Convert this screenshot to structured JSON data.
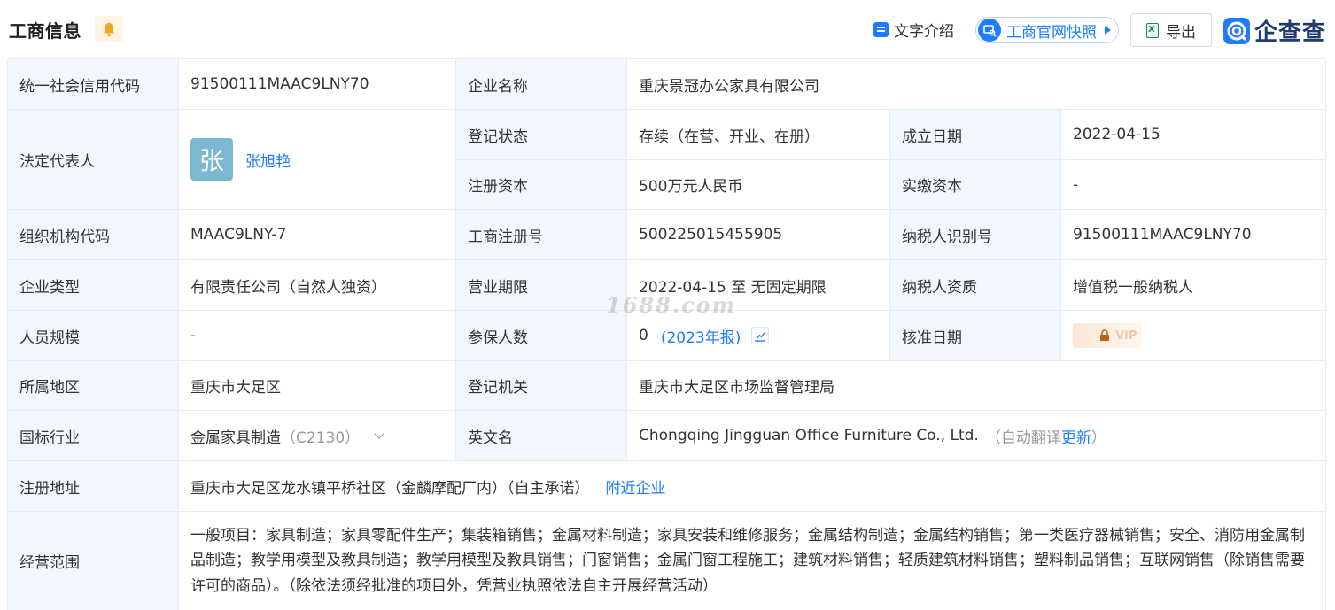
{
  "header": {
    "title": "工商信息",
    "intro_label": "文字介绍",
    "snapshot_label": "工商官网快照",
    "export_label": "导出",
    "logo_text": "企查查"
  },
  "labels": {
    "credit_code": "统一社会信用代码",
    "company_name": "企业名称",
    "legal_rep": "法定代表人",
    "reg_status": "登记状态",
    "founded": "成立日期",
    "reg_capital": "注册资本",
    "paid_capital": "实缴资本",
    "org_code": "组织机构代码",
    "biz_reg_no": "工商注册号",
    "taxpayer_id": "纳税人识别号",
    "company_type": "企业类型",
    "biz_term": "营业期限",
    "taxpayer_qual": "纳税人资质",
    "staff_size": "人员规模",
    "insured": "参保人数",
    "approval_date": "核准日期",
    "region": "所属地区",
    "reg_authority": "登记机关",
    "industry": "国标行业",
    "english_name": "英文名",
    "reg_address": "注册地址",
    "biz_scope": "经营范围"
  },
  "values": {
    "credit_code": "91500111MAAC9LNY70",
    "company_name": "重庆景冠办公家具有限公司",
    "legal_rep_avatar": "张",
    "legal_rep_name": "张旭艳",
    "reg_status": "存续（在营、开业、在册）",
    "founded": "2022-04-15",
    "reg_capital": "500万元人民币",
    "paid_capital": "-",
    "org_code": "MAAC9LNY-7",
    "biz_reg_no": "500225015455905",
    "taxpayer_id": "91500111MAAC9LNY70",
    "company_type": "有限责任公司（自然人独资）",
    "biz_term": "2022-04-15 至 无固定期限",
    "taxpayer_qual": "增值税一般纳税人",
    "staff_size": "-",
    "insured_count": "0",
    "insured_year": "(2023年报)",
    "approval_vip": "VIP",
    "region": "重庆市大足区",
    "reg_authority": "重庆市大足区市场监督管理局",
    "industry": "金属家具制造",
    "industry_code": "（C2130）",
    "english_name": "Chongqing Jingguan Office Furniture Co., Ltd.",
    "english_note_prefix": "（自动翻译",
    "english_update": "更新",
    "english_note_suffix": "）",
    "reg_address": "重庆市大足区龙水镇平桥社区（金麟摩配厂内）（自主承诺）",
    "nearby_link": "附近企业",
    "biz_scope": "一般项目：家具制造；家具零配件生产；集装箱销售；金属材料制造；家具安装和维修服务；金属结构制造；金属结构销售；第一类医疗器械销售；安全、消防用金属制品制造；教学用模型及教具制造；教学用模型及教具销售；门窗销售；金属门窗工程施工；建筑材料销售；轻质建筑材料销售；塑料制品销售；互联网销售（除销售需要许可的商品）。（除依法须经批准的项目外，凭营业执照依法自主开展经营活动）"
  },
  "watermark": "1688.com",
  "colors": {
    "accent": "#1f7bff",
    "label_bg": "#f2f7fe",
    "border": "#e4ecf7"
  }
}
